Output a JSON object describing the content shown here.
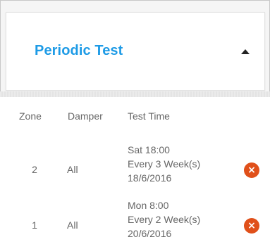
{
  "header": {
    "title": "Periodic Test",
    "toggle_icon": "caret-up-icon"
  },
  "table": {
    "columns": [
      "Zone",
      "Damper",
      "Test Time"
    ],
    "rows": [
      {
        "zone": "2",
        "damper": "All",
        "time_line1": "Sat 18:00",
        "time_line2": "Every 3 Week(s)",
        "time_line3": "18/6/2016",
        "action_icon": "delete-icon"
      },
      {
        "zone": "1",
        "damper": "All",
        "time_line1": "Mon 8:00",
        "time_line2": "Every 2 Week(s)",
        "time_line3": "20/6/2016",
        "action_icon": "delete-icon"
      }
    ]
  },
  "colors": {
    "title": "#1e9be6",
    "delete": "#e0501a"
  }
}
